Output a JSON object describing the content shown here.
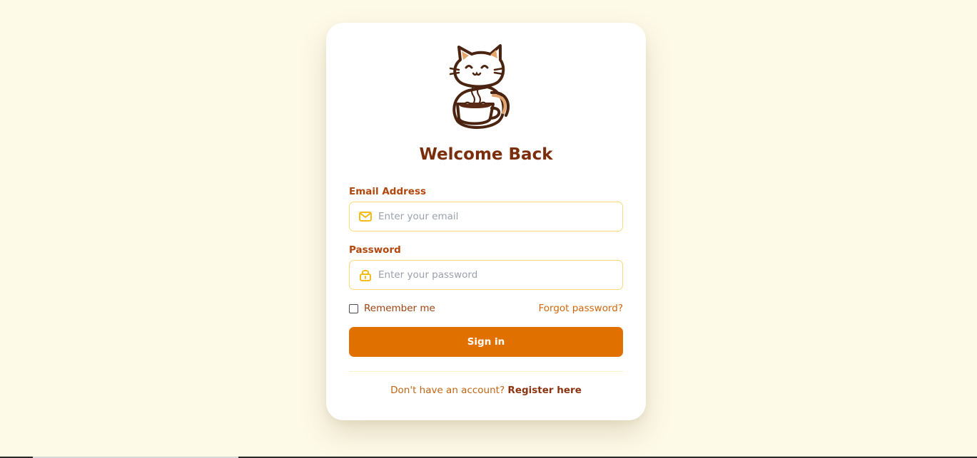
{
  "login": {
    "title": "Welcome Back",
    "email": {
      "label": "Email Address",
      "placeholder": "Enter your email",
      "value": "",
      "icon": "mail-icon"
    },
    "password": {
      "label": "Password",
      "placeholder": "Enter your password",
      "value": "",
      "icon": "lock-icon"
    },
    "remember_label": "Remember me",
    "remember_checked": false,
    "forgot_label": "Forgot password?",
    "signin_label": "Sign in",
    "register_prompt": "Don't have an account?",
    "register_link": "Register here",
    "logo": "cat-coffee-cup-logo"
  },
  "colors": {
    "background": "#fefae8",
    "card": "#ffffff",
    "title": "#7a2e0b",
    "label": "#b2470d",
    "input_border": "#fcd979",
    "icon": "#f4b400",
    "accent": "#e07000",
    "link": "#d0670a"
  }
}
